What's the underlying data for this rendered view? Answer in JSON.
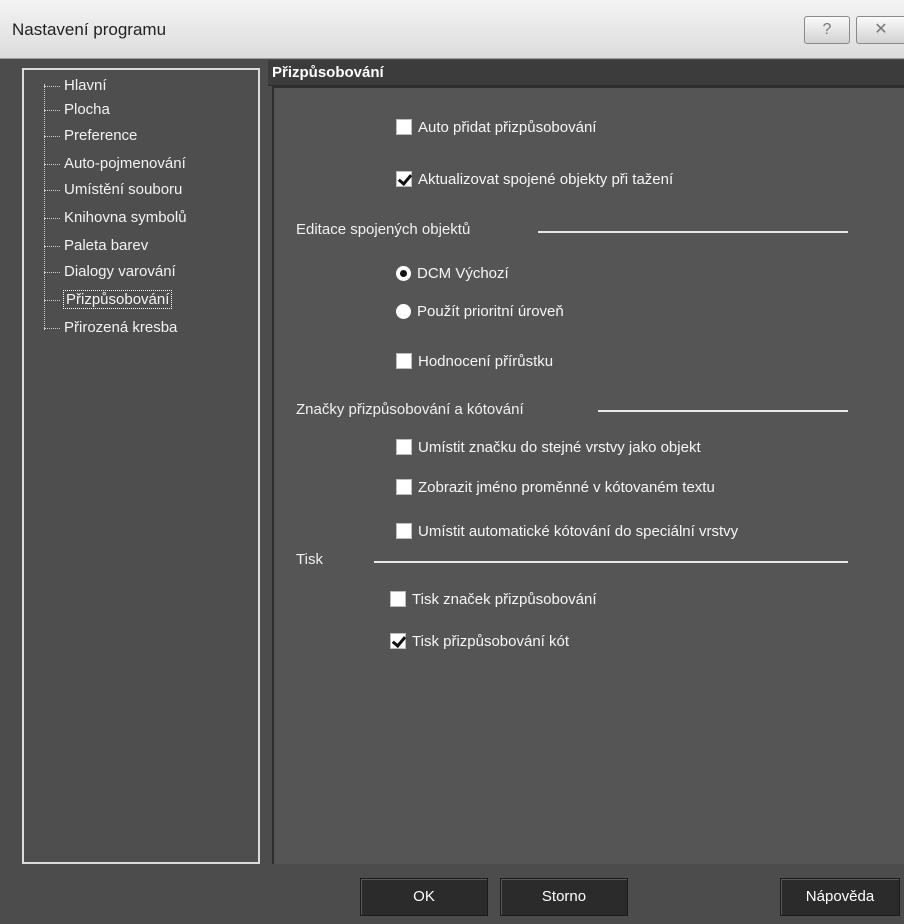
{
  "window": {
    "title": "Nastavení programu",
    "help_button": "?",
    "close_button": "✕"
  },
  "tree": {
    "items": [
      {
        "label": "Hlavní"
      },
      {
        "label": "Plocha"
      },
      {
        "label": "Preference"
      },
      {
        "label": "Auto-pojmenování"
      },
      {
        "label": "Umístění souboru"
      },
      {
        "label": "Knihovna symbolů"
      },
      {
        "label": "Paleta barev"
      },
      {
        "label": "Dialogy varování"
      },
      {
        "label": "Přizpůsobování",
        "selected": true
      },
      {
        "label": "Přirozená kresba"
      }
    ]
  },
  "panel": {
    "title": "Přizpůsobování",
    "auto_add": {
      "label": "Auto přidat přizpůsobování",
      "checked": false
    },
    "update_linked": {
      "label": "Aktualizovat spojené objekty při tažení",
      "checked": true
    },
    "group_linked": "Editace spojených objektů",
    "radio_dcm": {
      "label": "DCM Výchozí",
      "checked": true
    },
    "radio_priority": {
      "label": "Použít prioritní úroveň",
      "checked": false
    },
    "increment_eval": {
      "label": "Hodnocení přírůstku",
      "checked": false
    },
    "group_marks": "Značky přizpůsobování a kótování",
    "mark_same_layer": {
      "label": "Umístit značku do stejné vrstvy jako objekt",
      "checked": false
    },
    "show_var_name": {
      "label": "Zobrazit jméno proměnné v kótovaném textu",
      "checked": false
    },
    "auto_dim_layer": {
      "label": "Umístit automatické kótování do speciální vrstvy",
      "checked": false
    },
    "group_print": "Tisk",
    "print_marks": {
      "label": "Tisk značek přizpůsobování",
      "checked": false
    },
    "print_dims": {
      "label": "Tisk přizpůsobování kót",
      "checked": true
    }
  },
  "buttons": {
    "ok": "OK",
    "cancel": "Storno",
    "help": "Nápověda"
  }
}
